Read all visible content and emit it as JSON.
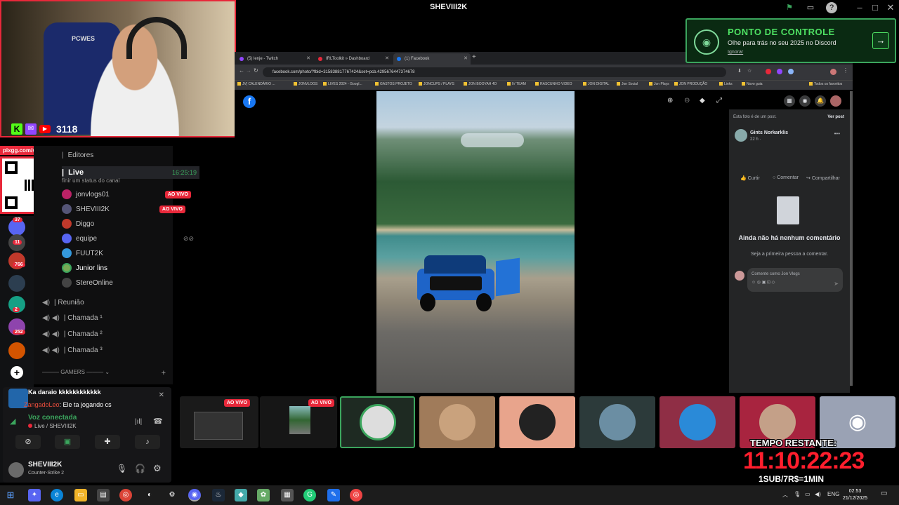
{
  "titlebar": {
    "app_name": "SHEVIII2K"
  },
  "webcam": {
    "viewer_count": "3118",
    "chair_brand": "PCWES"
  },
  "pix": {
    "label": "pixgg.com/sheviii2k"
  },
  "servers": {
    "badges": [
      "37",
      "11",
      "766",
      "2",
      "252"
    ]
  },
  "channels": {
    "editores": "Editores",
    "live_channel": "Live",
    "live_time": "16:25:19",
    "status_hint": "finir um status do canal",
    "members": [
      {
        "name": "jonvlogs01",
        "badge": "AO VIVO"
      },
      {
        "name": "SHEVIII2K",
        "badge": "AO VIVO"
      },
      {
        "name": "Diggo",
        "badge": ""
      },
      {
        "name": "equipe",
        "badge": ""
      },
      {
        "name": "FUUT2K",
        "badge": ""
      },
      {
        "name": "Junior lins",
        "badge": ""
      },
      {
        "name": "StereOnline",
        "badge": ""
      }
    ],
    "voice_channels": [
      "| Reunião",
      "| Chamada ¹",
      "| Chamada ²",
      "| Chamada ³"
    ],
    "category": "GAMERS"
  },
  "notification": {
    "line1": "Ka daraio kkkkkkkkkkkk",
    "author": "ZangadoLeo",
    "line2": ": Ele ta jogando cs"
  },
  "voice": {
    "status": "Voz conectada",
    "channel": "Live / SHEVIII2K"
  },
  "user": {
    "name": "SHEVIII2K",
    "activity": "Counter-Strike 2"
  },
  "browser": {
    "tabs": [
      {
        "label": "(5) lenje - Twitch",
        "color": "#9146ff"
      },
      {
        "label": "IRLToolkit » Dashboard",
        "color": "#e8283a"
      },
      {
        "label": "(1) Facebook",
        "color": "#1877f2"
      }
    ],
    "url": "facebook.com/photo/?fbid=315838817767424&set=pcb.4295676447374678",
    "bookmarks": [
      "JV| CALENDÁRIO ...",
      "JONVLOGS",
      "LIVES 2024 - Googl...",
      "GASTOS PROJETO",
      "JONCUPS / PLAYS",
      "JON BOOYAH 4D",
      "IV TEAM",
      "RASCUNHO VIDEO",
      "JON DIGITAL",
      "Jon Social",
      "Jon Plays",
      "JON PRODUÇÃO",
      "Links",
      "Novo guia",
      "Todos os favoritos"
    ]
  },
  "facebook": {
    "side_note": "Esta foto é de um post.",
    "see_post": "Ver post",
    "poster_name": "Gints Norkarklis",
    "poster_time": "22 h · ",
    "like": "Curtir",
    "comment": "Comentar",
    "share": "Compartilhar",
    "empty_title": "Ainda não há nenhum comentário",
    "empty_sub": "Seja a primeira pessoa a comentar.",
    "comment_placeholder": "Comente como Jon Vlogs"
  },
  "strip": {
    "live_badges": [
      "AO VIVO",
      "AO VIVO"
    ]
  },
  "promo": {
    "title": "PONTO DE CONTROLE",
    "subtitle": "Olhe para trás no seu 2025 no Discord",
    "ignore": "Ignorar"
  },
  "timer": {
    "label": "TEMPO RESTANTE:",
    "value": "11:10:22:23",
    "rate": "1SUB/7R$=1MIN"
  },
  "taskbar": {
    "lang": "ENG",
    "time": "02:53",
    "date": "21/12/2025"
  }
}
